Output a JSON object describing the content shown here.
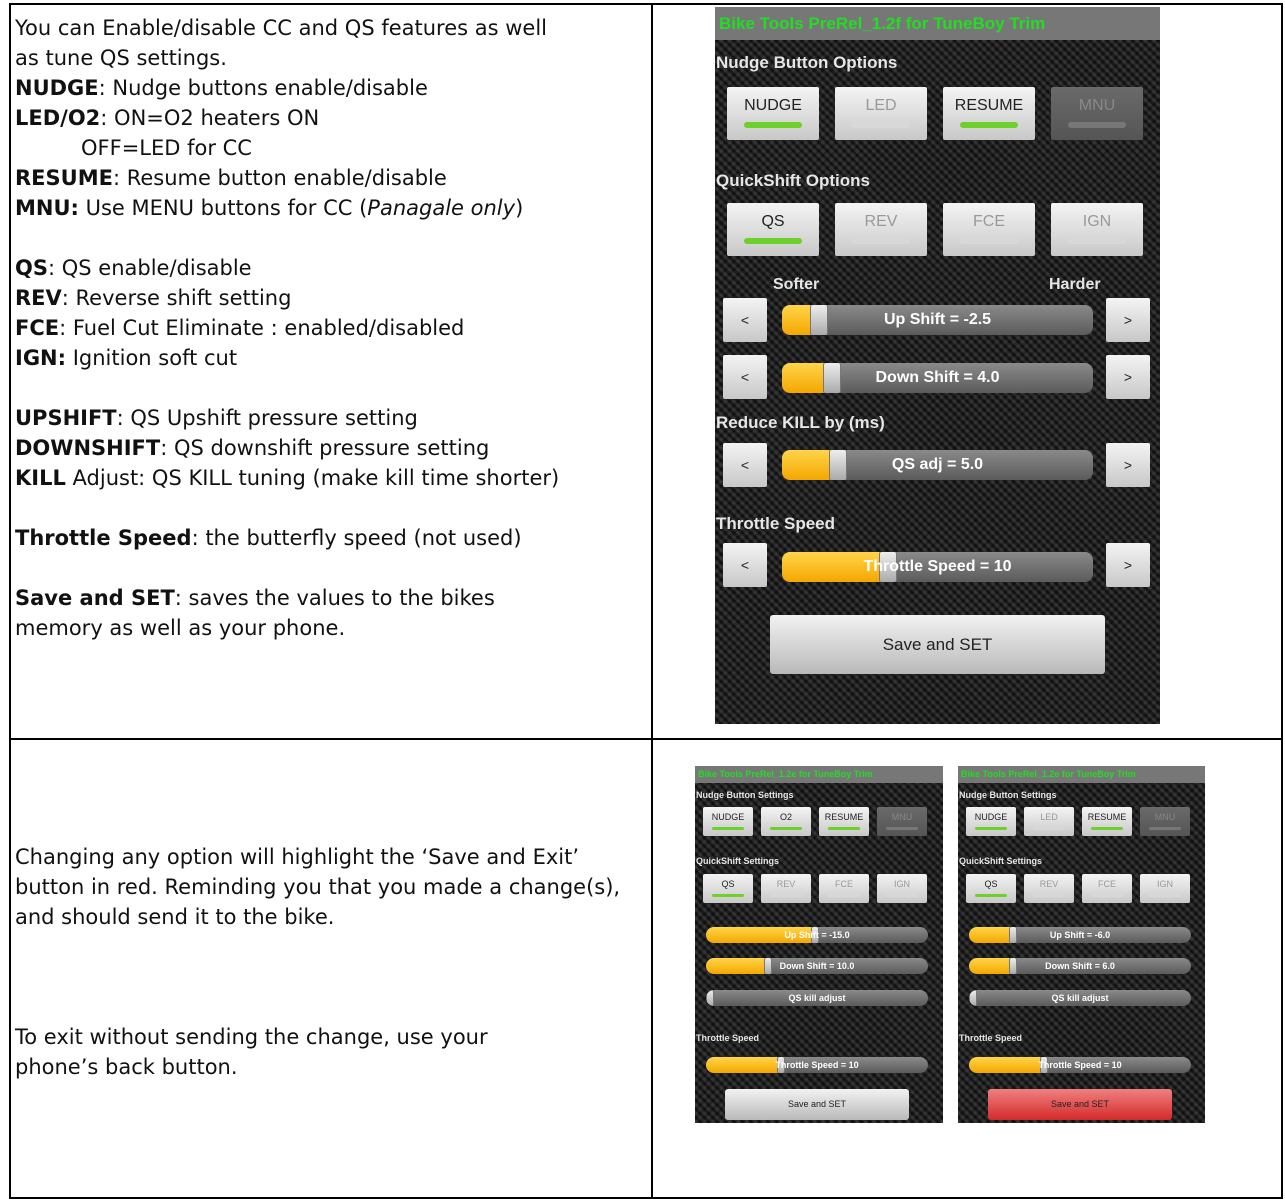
{
  "doc": {
    "top_text": [
      "You can Enable/disable CC and QS features as well",
      "as tune QS settings."
    ],
    "defs": [
      {
        "term": "NUDGE",
        "rest": ": Nudge buttons enable/disable"
      },
      {
        "term": "LED/O2",
        "rest": ": ON=O2 heaters ON"
      },
      {
        "term": "",
        "rest": "OFF=LED for CC"
      },
      {
        "term": "RESUME",
        "rest": ": Resume button enable/disable"
      },
      {
        "term": "MNU:",
        "rest": " Use MENU buttons for CC (",
        "italic": "Panagale only",
        "tail": ")"
      }
    ],
    "defs2": [
      {
        "term": "QS",
        "rest": ": QS enable/disable"
      },
      {
        "term": "REV",
        "rest": ": Reverse shift setting"
      },
      {
        "term": "FCE",
        "rest": ": Fuel Cut Eliminate : enabled/disabled"
      },
      {
        "term": "IGN:",
        "rest": " Ignition soft cut"
      }
    ],
    "defs3": [
      {
        "term": "UPSHIFT",
        "rest": ": QS Upshift pressure setting"
      },
      {
        "term": "DOWNSHIFT",
        "rest": ": QS downshift pressure setting"
      },
      {
        "term": "KILL",
        "rest": " Adjust: QS KILL tuning (make kill time shorter)"
      }
    ],
    "throttle_def": {
      "term": "Throttle Speed",
      "rest": ": the butterfly speed (not used)"
    },
    "save_def": {
      "term": "Save and SET",
      "rest": ": saves the values to the bikes",
      "line2": "memory as well as your phone."
    },
    "bottom_text_1": "Changing any option will highlight the ‘Save and Exit’ button in red. Reminding you that you made a change(s),  and should send it to the bike.",
    "bottom_text_2": "To exit without sending the change, use your phone’s back button."
  },
  "phone_main": {
    "title": "Bike Tools PreRel_1.2f for TuneBoy Trim",
    "nudge_section": "Nudge Button Options",
    "nudge_buttons": [
      {
        "label": "NUDGE",
        "state": "on"
      },
      {
        "label": "LED",
        "state": "off"
      },
      {
        "label": "RESUME",
        "state": "on"
      },
      {
        "label": "MNU",
        "state": "disabled"
      }
    ],
    "qs_section": "QuickShift Options",
    "qs_buttons": [
      {
        "label": "QS",
        "state": "on"
      },
      {
        "label": "REV",
        "state": "off"
      },
      {
        "label": "FCE",
        "state": "off"
      },
      {
        "label": "IGN",
        "state": "off"
      }
    ],
    "softer": "Softer",
    "harder": "Harder",
    "up_shift": {
      "label": "Up Shift = -2.5",
      "fill": 0.12
    },
    "down_shift": {
      "label": "Down Shift = 4.0",
      "fill": 0.16
    },
    "kill_section": "Reduce KILL by (ms)",
    "qs_adj": {
      "label": "QS adj = 5.0",
      "fill": 0.18
    },
    "throttle_section": "Throttle Speed",
    "throttle": {
      "label": "Throttle Speed = 10",
      "fill": 0.34
    },
    "left_btn": "<",
    "right_btn": ">",
    "save": "Save and SET"
  },
  "phone_a": {
    "title": "Bike Tools PreRel_1.2e for TuneBoy Trim",
    "nudge_section": "Nudge Button Settings",
    "nudge_buttons": [
      {
        "label": "NUDGE",
        "state": "on"
      },
      {
        "label": "O2",
        "state": "on"
      },
      {
        "label": "RESUME",
        "state": "on"
      },
      {
        "label": "MNU",
        "state": "disabled"
      }
    ],
    "qs_section": "QuickShift Settings",
    "qs_buttons": [
      {
        "label": "QS",
        "state": "on"
      },
      {
        "label": "REV",
        "state": "off"
      },
      {
        "label": "FCE",
        "state": "off"
      },
      {
        "label": "IGN",
        "state": "off"
      }
    ],
    "up_shift": {
      "label": "Up Shift = -15.0",
      "fill": 0.49
    },
    "down_shift": {
      "label": "Down Shift = 10.0",
      "fill": 0.28
    },
    "qs_kill": {
      "label": "QS kill adjust",
      "fill": 0.0
    },
    "throttle_section": "Throttle Speed",
    "throttle": {
      "label": "Throttle Speed = 10",
      "fill": 0.34
    },
    "save": "Save and SET",
    "save_color": "#c8c8c8"
  },
  "phone_b": {
    "title": "Bike Tools PreRel_1.2e for TuneBoy Trim",
    "nudge_section": "Nudge Button Settings",
    "nudge_buttons": [
      {
        "label": "NUDGE",
        "state": "on"
      },
      {
        "label": "LED",
        "state": "off"
      },
      {
        "label": "RESUME",
        "state": "on"
      },
      {
        "label": "MNU",
        "state": "disabled"
      }
    ],
    "qs_section": "QuickShift Settings",
    "qs_buttons": [
      {
        "label": "QS",
        "state": "on"
      },
      {
        "label": "REV",
        "state": "off"
      },
      {
        "label": "FCE",
        "state": "off"
      },
      {
        "label": "IGN",
        "state": "off"
      }
    ],
    "up_shift": {
      "label": "Up Shift = -6.0",
      "fill": 0.2
    },
    "down_shift": {
      "label": "Down Shift = 6.0",
      "fill": 0.2
    },
    "qs_kill": {
      "label": "QS kill adjust",
      "fill": 0.0
    },
    "throttle_section": "Throttle Speed",
    "throttle": {
      "label": "Throttle Speed = 10",
      "fill": 0.34
    },
    "save": "Save and SET",
    "save_color": "#d93030"
  },
  "colors": {
    "title_text": "#22dd22",
    "slider_fill": "#f4b400",
    "toggle_on": "#6ed02a",
    "save_changed": "#d93030"
  }
}
